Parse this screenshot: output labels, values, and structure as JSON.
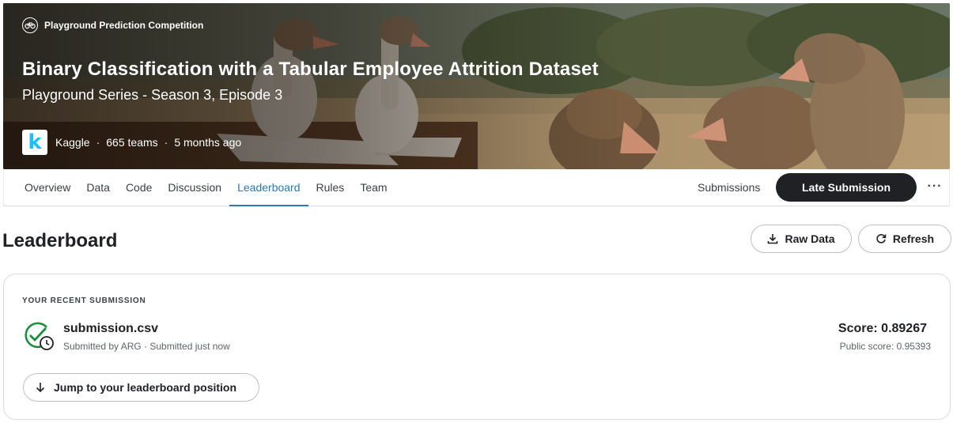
{
  "hero": {
    "competition_type": "Playground Prediction Competition",
    "title": "Binary Classification with a Tabular Employee Attrition Dataset",
    "subtitle": "Playground Series - Season 3, Episode 3",
    "logo_letter": "k",
    "host": "Kaggle",
    "separator": "·",
    "teams": "665 teams",
    "time_ago": "5 months ago"
  },
  "tabs": [
    "Overview",
    "Data",
    "Code",
    "Discussion",
    "Leaderboard",
    "Rules",
    "Team"
  ],
  "active_tab": "Leaderboard",
  "nav_right": {
    "submissions_label": "Submissions",
    "late_submission_label": "Late Submission",
    "more_label": "···"
  },
  "leaderboard": {
    "title": "Leaderboard",
    "raw_data_label": "Raw Data",
    "refresh_label": "Refresh"
  },
  "recent_submission": {
    "section_label": "YOUR RECENT SUBMISSION",
    "file_name": "submission.csv",
    "meta": "Submitted by ARG · Submitted just now",
    "score": "Score: 0.89267",
    "public_score": "Public score: 0.95393",
    "jump_label": "Jump to your leaderboard position"
  },
  "icons": {
    "competition_type": "bicycle-icon",
    "host_logo": "kaggle-logo",
    "download": "download-icon",
    "refresh": "refresh-icon",
    "status": "check-clock-icon",
    "jump": "arrow-down-icon"
  },
  "colors": {
    "primary_dark": "#202124",
    "active_tab": "#2a7ab8",
    "success_green": "#1e8e3e",
    "kaggle_blue": "#20beff"
  }
}
